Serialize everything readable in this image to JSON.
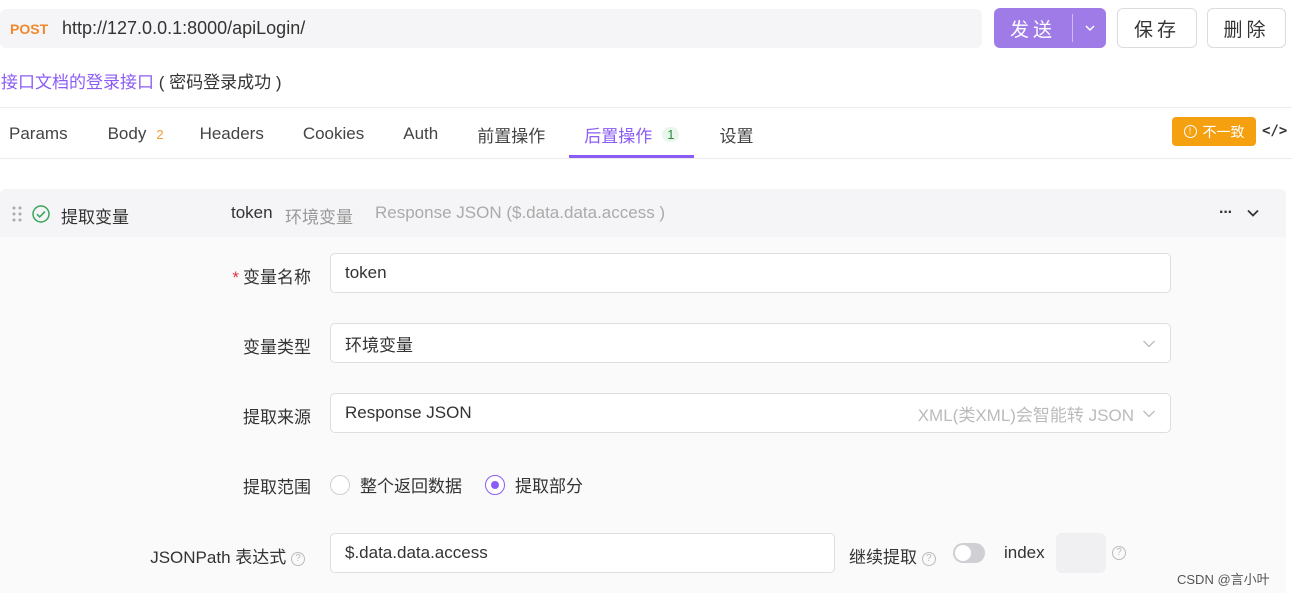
{
  "request": {
    "method": "POST",
    "url": "http://127.0.0.1:8000/apiLogin/"
  },
  "actions": {
    "send_label": "发送",
    "save_label": "保存",
    "delete_label": "删除"
  },
  "doc": {
    "name": "接口文档的登录接口",
    "status": "( 密码登录成功 )"
  },
  "tabs": [
    {
      "label": "Params",
      "count": ""
    },
    {
      "label": "Body",
      "count": "2"
    },
    {
      "label": "Headers",
      "count": ""
    },
    {
      "label": "Cookies",
      "count": ""
    },
    {
      "label": "Auth",
      "count": ""
    },
    {
      "label": "前置操作",
      "count": ""
    },
    {
      "label": "后置操作",
      "count": "1"
    },
    {
      "label": "设置",
      "count": ""
    }
  ],
  "inconsistent_badge": "不一致",
  "extract": {
    "title": "提取变量",
    "summary_var": "token",
    "summary_type": "环境变量",
    "summary_source": "Response JSON ($.data.data.access )",
    "fields": {
      "name_label": "变量名称",
      "name_value": "token",
      "type_label": "变量类型",
      "type_value": "环境变量",
      "source_label": "提取来源",
      "source_value": "Response JSON",
      "source_hint": "XML(类XML)会智能转 JSON",
      "scope_label": "提取范围",
      "scope_option_all": "整个返回数据",
      "scope_option_part": "提取部分",
      "jsonpath_label": "JSONPath 表达式",
      "jsonpath_value": "$.data.data.access",
      "continue_label": "继续提取",
      "index_label": "index"
    }
  },
  "watermark": "CSDN @言小叶",
  "colors": {
    "accent": "#8b5cf6",
    "send_button": "#9f7be8",
    "method": "#f0892e",
    "warning": "#f5a00f"
  }
}
